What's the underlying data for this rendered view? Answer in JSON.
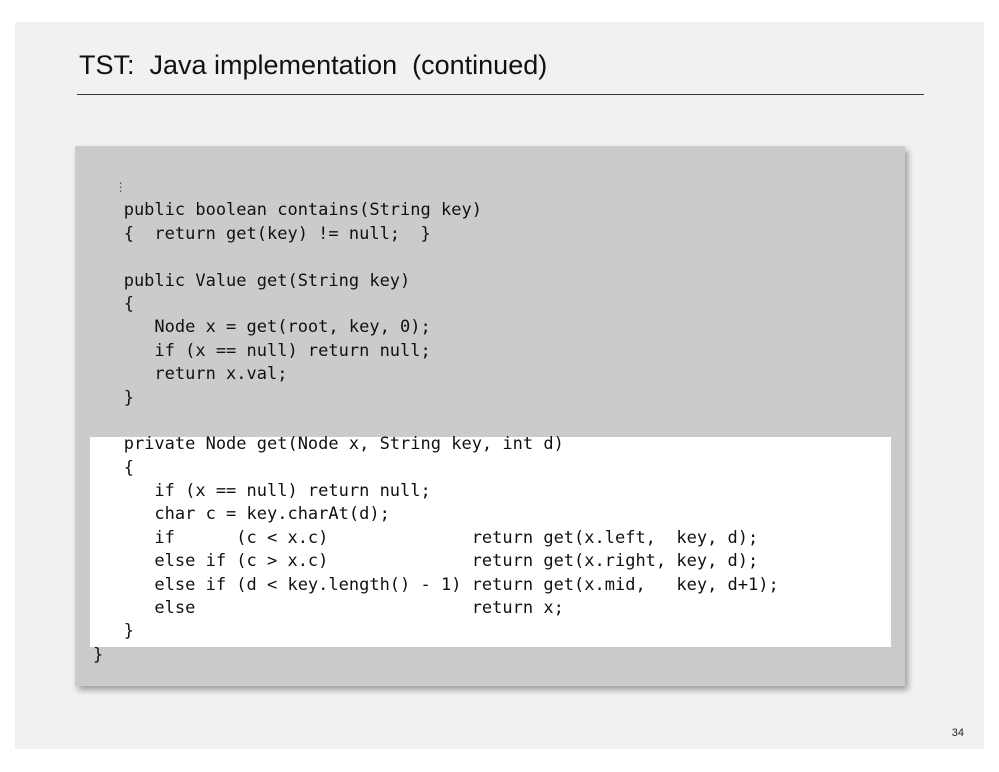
{
  "slide": {
    "title": "TST:  Java implementation  (continued)",
    "page_number": "34"
  },
  "code": {
    "lines": [
      "   ⋮",
      "   public boolean contains(String key)",
      "   {  return get(key) != null;  }",
      "",
      "   public Value get(String key)",
      "   {",
      "      Node x = get(root, key, 0);",
      "      if (x == null) return null;",
      "      return x.val;",
      "   }",
      "",
      "   private Node get(Node x, String key, int d)",
      "   {",
      "      if (x == null) return null;",
      "      char c = key.charAt(d);",
      "      if      (c < x.c)              return get(x.left,  key, d);",
      "      else if (c > x.c)              return get(x.right, key, d);",
      "      else if (d < key.length() - 1) return get(x.mid,   key, d+1);",
      "      else                           return x;",
      "   }",
      "}"
    ]
  },
  "colors": {
    "slide_background": "#f1f1f1",
    "code_panel_background": "#cbcbcb",
    "highlight_background": "#ffffff",
    "text": "#111111"
  }
}
